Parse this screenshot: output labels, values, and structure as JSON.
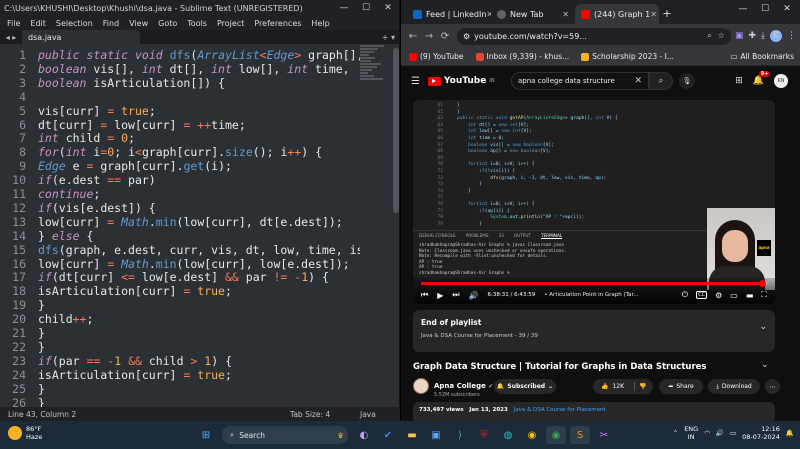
{
  "sublime": {
    "title": "C:\\Users\\KHUSHI\\Desktop\\Khushi\\dsa.java - Sublime Text (UNREGISTERED)",
    "menu": [
      "File",
      "Edit",
      "Selection",
      "Find",
      "View",
      "Goto",
      "Tools",
      "Project",
      "Preferences",
      "Help"
    ],
    "tab": "dsa.java",
    "status": {
      "position": "Line 43, Column 2",
      "tab_size": "Tab Size: 4",
      "syntax": "Java"
    },
    "line_numbers": [
      "1",
      "2",
      "3",
      "4",
      "5",
      "6",
      "7",
      "8",
      "9",
      "10",
      "11",
      "12",
      "13",
      "14",
      "15",
      "16",
      "17",
      "18",
      "19",
      "20",
      "21",
      "22",
      "23",
      "24",
      "25",
      "26"
    ],
    "code_lines": [
      "public static void dfs(ArrayList<Edge> graph[], int curr, int par,",
      "boolean vis[], int dt[], int low[], int time,",
      "boolean isArticulation[]) {",
      "",
      "vis[curr] = true;",
      "dt[curr] = low[curr] = ++time;",
      "int child = 0;",
      "for(int i=0; i<graph[curr].size(); i++) {",
      "Edge e = graph[curr].get(i);",
      "if(e.dest == par)",
      "continue;",
      "if(vis[e.dest]) {",
      "low[curr] = Math.min(low[curr], dt[e.dest]);",
      "} else {",
      "dfs(graph, e.dest, curr, vis, dt, low, time, isArticulation);",
      "low[curr] = Math.min(low[curr], low[e.dest]);",
      "if(dt[curr] <= low[e.dest] && par != -1) {",
      "isArticulation[curr] = true;",
      "}",
      "child++;",
      "}",
      "}",
      "if(par == -1 && child > 1) {",
      "isArticulation[curr] = true;",
      "}",
      "}"
    ]
  },
  "chrome": {
    "tabs": [
      {
        "label": "Feed | LinkedIn",
        "color": "#0a66c2"
      },
      {
        "label": "New Tab",
        "color": "#5f6368"
      },
      {
        "label": "(244) Graph 1",
        "color": "#ff0000"
      }
    ],
    "url": "youtube.com/watch?v=59...",
    "profile": "K",
    "bookmarks": [
      {
        "label": "(9) YouTube",
        "color": "#ff0000"
      },
      {
        "label": "Inbox (9,339) - khus...",
        "color": "#ea4335"
      },
      {
        "label": "Scholarship 2023 - I...",
        "color": "#f5b323"
      }
    ],
    "all_bookmarks": "All Bookmarks"
  },
  "youtube": {
    "logo": "YouTube",
    "logo_region": "IN",
    "search_value": "apna college data structure",
    "notif_count": "9+",
    "avatar": "KN",
    "video_code_lines": [
      {
        "n": "61",
        "c": "}"
      },
      {
        "n": "62",
        "c": "}"
      },
      {
        "n": "63",
        "c": "public static void getAP(ArrayList<Edge> graph[], int V) {"
      },
      {
        "n": "64",
        "c": "    int dt[] = new int[V];"
      },
      {
        "n": "65",
        "c": "    int low[] = new int[V];"
      },
      {
        "n": "66",
        "c": "    int time = 0;"
      },
      {
        "n": "67",
        "c": "    boolean vis[] = new boolean[V];"
      },
      {
        "n": "68",
        "c": "    boolean ap[] = new boolean[V];"
      },
      {
        "n": "69",
        "c": ""
      },
      {
        "n": "70",
        "c": "    for(int i=0; i<V; i++) {"
      },
      {
        "n": "71",
        "c": "        if(!vis[i]) {"
      },
      {
        "n": "72",
        "c": "            dfs(graph, i, -1, dt, low, vis, time, ap);"
      },
      {
        "n": "73",
        "c": "        }"
      },
      {
        "n": "74",
        "c": "    }"
      },
      {
        "n": "75",
        "c": ""
      },
      {
        "n": "76",
        "c": "    for(int i=0; i<V; i++) {"
      },
      {
        "n": "77",
        "c": "        if(ap[i]) {"
      },
      {
        "n": "78",
        "c": "            System.out.println(\"AP : \"+ap(i));"
      },
      {
        "n": "79",
        "c": "        }"
      }
    ],
    "terminal_tabs": [
      "DEBUG CONSOLE",
      "PROBLEMS",
      "33",
      "OUTPUT",
      "TERMINAL"
    ],
    "terminal_lines": [
      "shradhakhapra@Shradhas-Air Graphs % javac Classroom.java",
      "Note: Classroom.java uses unchecked or unsafe operations.",
      "Note: Recompile with -Xlint:unchecked for details.",
      "AP : true",
      "AP : true",
      "shradhakhapra@Shradhas-Air Graphs % "
    ],
    "cam_label": "apna",
    "time": "6:38:31 / 6:43:59",
    "chapter": "• Articulation Point in Graph (Tar...",
    "progress": 0.985,
    "end_title": "End of playlist",
    "end_sub": "Java & DSA Course for Placement - 39 / 39",
    "title": "Graph Data Structure | Tutorial for Graphs in Data Structures",
    "channel": "Apna College",
    "subscribers": "5.52M subscribers",
    "subscribe_label": "Subscribed",
    "likes": "12K",
    "share_label": "Share",
    "download_label": "Download",
    "views": "733,497 views",
    "date": "Jan 13, 2023",
    "course_tag": "Java & DSA Course for Placement"
  },
  "taskbar": {
    "temp": "86°F",
    "weather": "Haze",
    "search_placeholder": "Search",
    "lang1": "ENG",
    "lang2": "IN",
    "time": "12:16",
    "date": "08-07-2024"
  }
}
